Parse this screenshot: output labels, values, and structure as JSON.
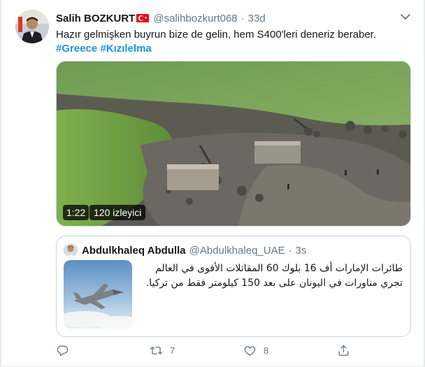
{
  "tweet": {
    "display_name": "Salih BOZKURT",
    "handle": "@salihbozkurt068",
    "separator": "·",
    "time": "33d",
    "text": "Hazır gelmişken buyrun bize de gelin, hem S400'leri deneriz beraber.",
    "hashtags": [
      "#Greece",
      "#Kızılelma"
    ],
    "media": {
      "duration": "1:22",
      "views": "120 izleyici"
    }
  },
  "quoted_tweet": {
    "display_name": "Abdulkhaleq Abdulla",
    "handle": "@Abdulkhaleq_UAE",
    "separator": "·",
    "time": "3s",
    "text_line1": "طائرات الإمارات أف 16 بلوك 60 المقاتلات الأقوى في العالم",
    "text_line2": "تجري مناورات في اليونان على بعد 150 كيلومتر فقط من تركيا."
  },
  "actions": {
    "reply_count": "",
    "retweet_count": "7",
    "like_count": "8",
    "share_count": ""
  },
  "icons": {
    "more": "more-chevron-icon",
    "reply": "reply-icon",
    "retweet": "retweet-icon",
    "like": "like-icon",
    "share": "share-icon",
    "flag": "turkish-flag-icon"
  },
  "colors": {
    "link": "#1b95e0",
    "secondary_text": "#657786",
    "border": "#ccd6dd"
  }
}
